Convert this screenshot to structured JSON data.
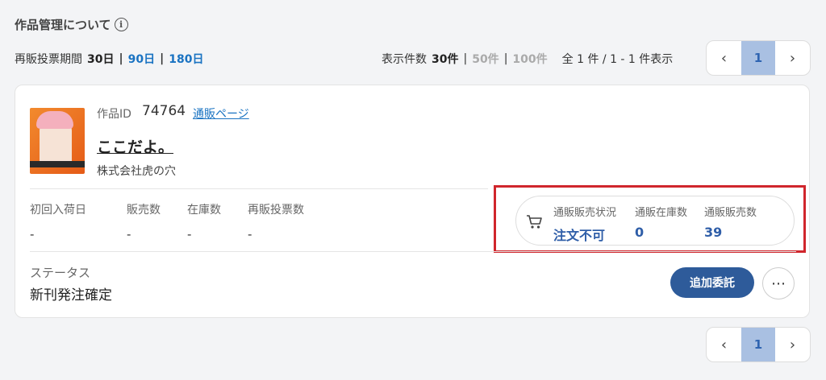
{
  "header": {
    "title": "作品管理について",
    "info_icon": "i"
  },
  "resale_period": {
    "label": "再販投票期間",
    "current": "30日",
    "option_90": "90日",
    "option_180": "180日",
    "sep": "|"
  },
  "per_page": {
    "label": "表示件数",
    "current": "30件",
    "option_50": "50件",
    "option_100": "100件",
    "sep": "|",
    "range": "全 1 件 / 1 - 1 件表示"
  },
  "pagination": {
    "prev": "‹",
    "page": "1",
    "next": "›"
  },
  "work": {
    "id_label": "作品ID",
    "id": "74764",
    "shop_link": "通販ページ",
    "title": "ここだよ。",
    "publisher": "株式会社虎の穴",
    "stats": [
      {
        "label": "初回入荷日",
        "value": "-"
      },
      {
        "label": "販売数",
        "value": "-"
      },
      {
        "label": "在庫数",
        "value": "-"
      },
      {
        "label": "再販投票数",
        "value": "-"
      }
    ],
    "shop_status": {
      "icon": "cart-icon",
      "status_label": "通販販売状況",
      "status_value": "注文不可",
      "stock_label": "通販在庫数",
      "stock_value": "0",
      "sold_label": "通販販売数",
      "sold_value": "39"
    },
    "status_label": "ステータス",
    "status_value": "新刊発注確定",
    "add_button": "追加委託",
    "more_button": "⋯"
  },
  "colors": {
    "accent": "#2e5b9a",
    "link": "#1a73c2",
    "highlight": "#d0262c",
    "page_active": "#a9c0e2"
  }
}
